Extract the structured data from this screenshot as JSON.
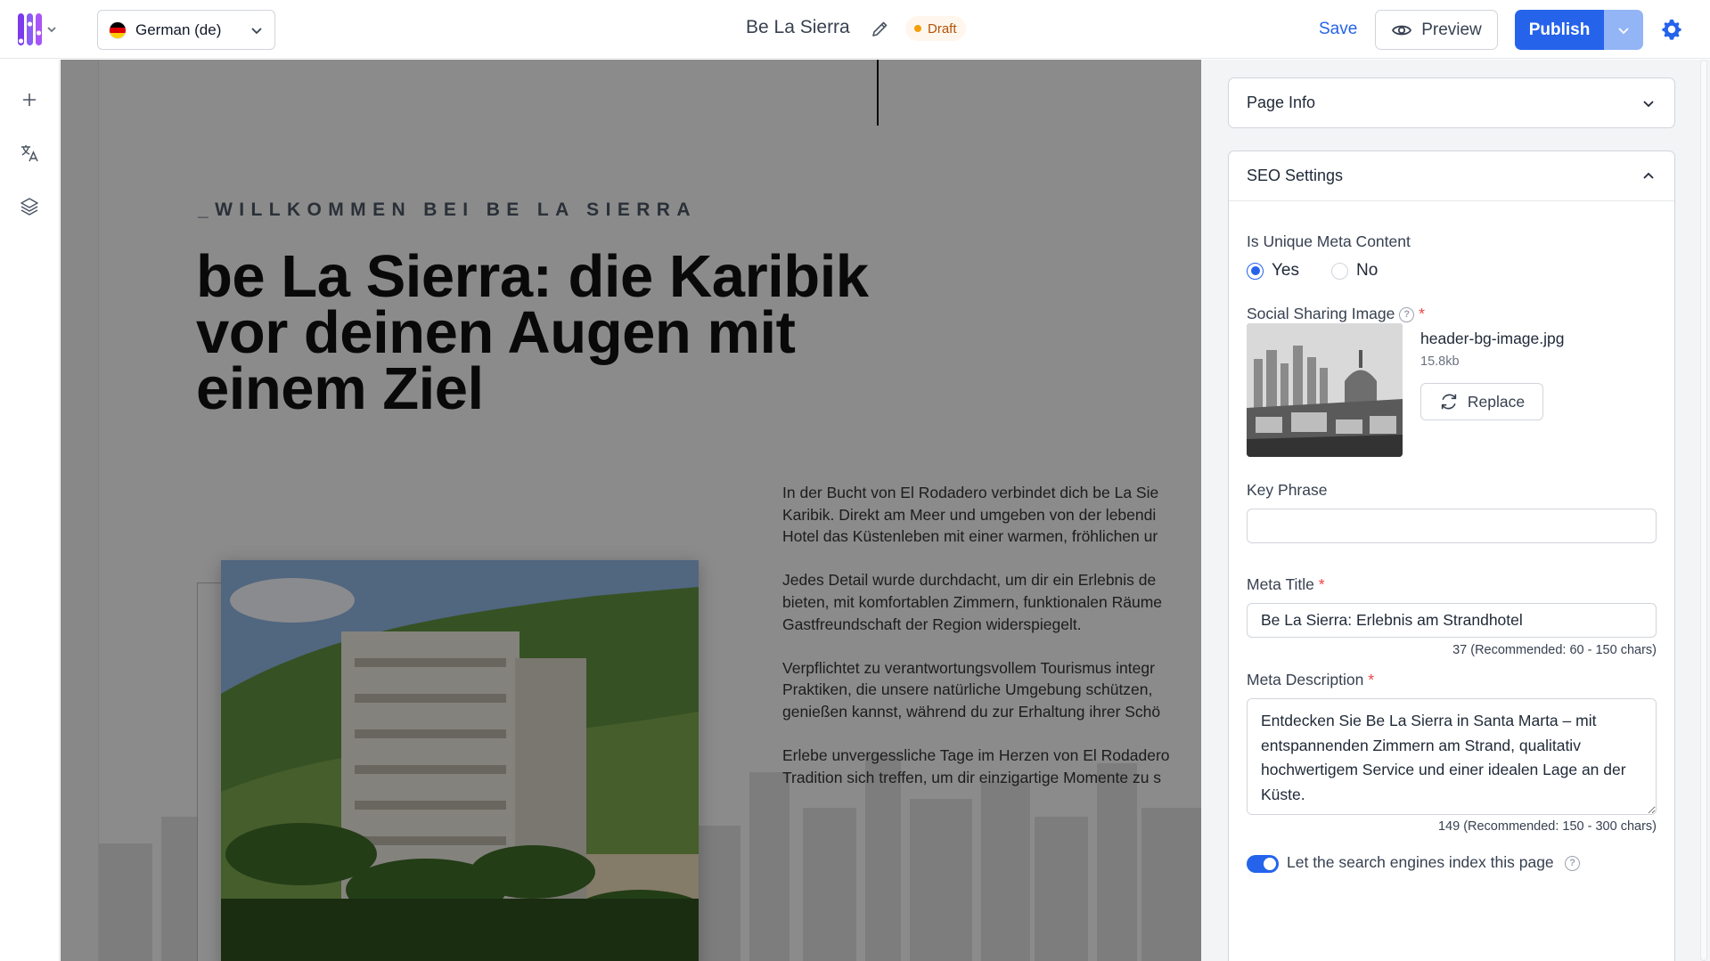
{
  "app": {
    "page_name": "Be La Sierra",
    "status": "Draft",
    "language": "German (de)"
  },
  "toolbar": {
    "save_label": "Save",
    "preview_label": "Preview",
    "publish_label": "Publish"
  },
  "canvas": {
    "eyebrow": "_WILLKOMMEN BEI BE LA SIERRA",
    "title_lines": [
      "be La Sierra: die Karibik",
      "vor deinen Augen mit",
      "einem Ziel"
    ],
    "paragraphs": [
      {
        "lines": [
          "In der Bucht von El Rodadero verbindet dich be La Sie",
          "Karibik. Direkt am Meer und umgeben von der lebendi",
          "Hotel das Küstenleben mit einer warmen, fröhlichen ur"
        ]
      },
      {
        "lines": [
          "Jedes Detail wurde durchdacht, um dir ein Erlebnis de",
          "bieten, mit komfortablen Zimmern, funktionalen Räume",
          "Gastfreundschaft der Region widerspiegelt."
        ]
      },
      {
        "lines": [
          "Verpflichtet zu verantwortungsvollem Tourismus integr",
          "Praktiken, die unsere natürliche Umgebung schützen,",
          "genießen kannst, während du zur Erhaltung ihrer Schö"
        ]
      },
      {
        "lines": [
          "Erlebe unvergessliche Tage im Herzen von El Rodadero",
          "Tradition sich treffen, um dir einzigartige Momente zu s"
        ]
      }
    ]
  },
  "panel": {
    "page_info_title": "Page Info",
    "seo_title": "SEO Settings",
    "unique_meta_label": "Is Unique Meta Content",
    "unique_meta_options": [
      "Yes",
      "No"
    ],
    "unique_meta_selected": "Yes",
    "social_image_label": "Social Sharing Image",
    "social_image_file": "header-bg-image.jpg",
    "social_image_size": "15.8kb",
    "replace_label": "Replace",
    "key_phrase_label": "Key Phrase",
    "key_phrase_value": "",
    "meta_title_label": "Meta Title",
    "meta_title_value": "Be La Sierra: Erlebnis am Strandhotel",
    "meta_title_count": "37 (Recommended: 60 - 150 chars)",
    "meta_description_label": "Meta Description",
    "meta_description_value": "Entdecken Sie Be La Sierra in Santa Marta – mit entspannenden Zimmern am Strand, qualitativ hochwertigem Service und einer idealen Lage an der Küste.",
    "meta_description_count": "149 (Recommended: 150 - 300 chars)",
    "index_label": "Let the search engines index this page",
    "index_enabled": true
  },
  "colors": {
    "accent": "#2563eb",
    "draft": "#f59e0b",
    "required": "#ef4444",
    "overlay": "rgba(0,0,0,0.43)"
  },
  "icons": {
    "rail": [
      "plus-icon",
      "translate-icon",
      "layers-icon"
    ],
    "topbar": [
      "logo-icon",
      "pencil-icon",
      "eye-icon",
      "settings-icon"
    ]
  }
}
